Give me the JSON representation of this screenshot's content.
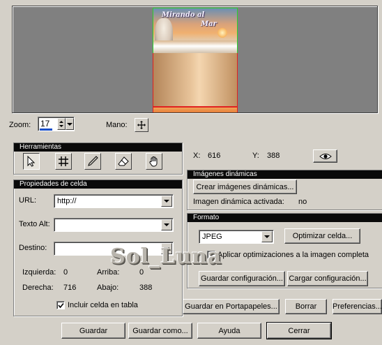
{
  "preview": {
    "image_title_line1": "Mirando al",
    "image_title_line2": "Mar"
  },
  "zoom": {
    "label": "Zoom:",
    "value": "17",
    "hand_label": "Mano:"
  },
  "tools": {
    "title": "Herramientas",
    "items": [
      "pointer-icon",
      "slice-grid-icon",
      "pen-icon",
      "eraser-icon",
      "hand-icon"
    ],
    "selected": "pointer-icon"
  },
  "coords": {
    "x_label": "X:",
    "x_value": "616",
    "y_label": "Y:",
    "y_value": "388"
  },
  "cell_props": {
    "title": "Propiedades de celda",
    "url_label": "URL:",
    "url_value": "http://",
    "alt_label": "Texto Alt:",
    "alt_value": "",
    "target_label": "Destino:",
    "target_value": "",
    "left_label": "Izquierda:",
    "left_value": "0",
    "top_label": "Arriba:",
    "top_value": "0",
    "right_label": "Derecha:",
    "right_value": "716",
    "bottom_label": "Abajo:",
    "bottom_value": "388",
    "include_label": "Incluir celda en tabla",
    "include_checked": true
  },
  "dynamic": {
    "title": "Imágenes dinámicas",
    "create_button": "Crear imágenes dinámicas...",
    "status_label": "Imagen dinámica activada:",
    "status_value": "no"
  },
  "format": {
    "title": "Formato",
    "selected": "JPEG",
    "optimize_button": "Optimizar celda...",
    "apply_label": "Aplicar optimizaciones a la imagen completa",
    "save_config_button": "Guardar configuración...",
    "load_config_button": "Cargar configuración..."
  },
  "actions": {
    "clipboard": "Guardar en Portapapeles...",
    "delete": "Borrar",
    "preferences": "Preferencias..."
  },
  "footer": {
    "save": "Guardar",
    "save_as": "Guardar como...",
    "help": "Ayuda",
    "close": "Cerrar"
  },
  "watermark": "Sol_Luna"
}
